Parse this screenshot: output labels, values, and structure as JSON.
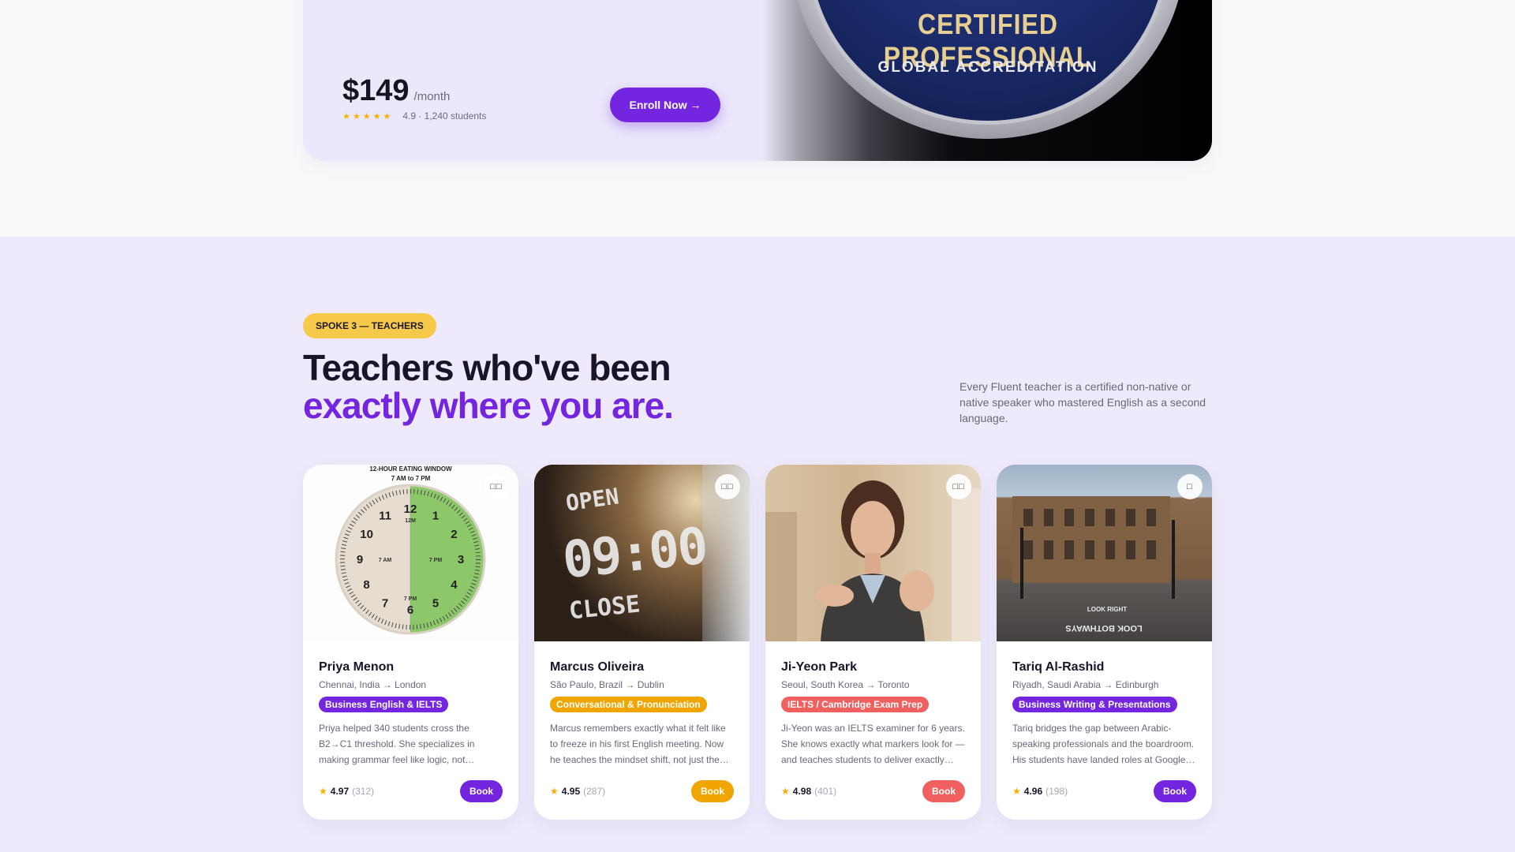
{
  "course": {
    "badge_title": "CERTIFIED PROFESSIONAL",
    "badge_subtitle": "GLOBAL ACCREDITATION",
    "price": "$149",
    "price_unit": "/month",
    "rating_stars": "★★★★★",
    "rating_text": "4.9 · 1,240 students",
    "enroll_label": "Enroll Now →"
  },
  "teachers_section": {
    "tag": "SPOKE 3 — TEACHERS",
    "headline_line1": "Teachers who've been",
    "headline_line2": "exactly where you are.",
    "description": "Every Fluent teacher is a certified non-native or native speaker who mastered English as a second language."
  },
  "teachers": [
    {
      "name": "Priya Menon",
      "route": "Chennai, India → London",
      "specialty": "Business English & IELTS",
      "bio": "Priya helped 340 students cross the B2→C1 threshold. She specializes in making grammar feel like logic, not…",
      "star": "★",
      "rating": "4.97",
      "reviews": "(312)",
      "book_label": "Book",
      "photo_icon": "□□",
      "accent": "#7425e0"
    },
    {
      "name": "Marcus Oliveira",
      "route": "São Paulo, Brazil → Dublin",
      "specialty": "Conversational & Pronunciation",
      "bio": "Marcus remembers exactly what it felt like to freeze in his first English meeting. Now he teaches the mindset shift, not just the…",
      "star": "★",
      "rating": "4.95",
      "reviews": "(287)",
      "book_label": "Book",
      "photo_icon": "□□",
      "accent": "#f0a500"
    },
    {
      "name": "Ji-Yeon Park",
      "route": "Seoul, South Korea → Toronto",
      "specialty": "IELTS / Cambridge Exam Prep",
      "bio": "Ji-Yeon was an IELTS examiner for 6 years. She knows exactly what markers look for — and teaches students to deliver exactly…",
      "star": "★",
      "rating": "4.98",
      "reviews": "(401)",
      "book_label": "Book",
      "photo_icon": "□□",
      "accent": "#f0605f"
    },
    {
      "name": "Tariq Al-Rashid",
      "route": "Riyadh, Saudi Arabia → Edinburgh",
      "specialty": "Business Writing & Presentations",
      "bio": "Tariq bridges the gap between Arabic-speaking professionals and the boardroom. His students have landed roles at Google…",
      "star": "★",
      "rating": "4.96",
      "reviews": "(198)",
      "book_label": "Book",
      "photo_icon": "□",
      "accent": "#7425e0"
    }
  ],
  "photo_texts": {
    "clock_caption": "12-HOUR EATING WINDOW",
    "clock_subcaption": "7 AM to 7 PM",
    "clock_numbers": [
      "12",
      "1",
      "2",
      "3",
      "4",
      "5",
      "6",
      "7",
      "8",
      "9",
      "10",
      "11"
    ],
    "clock_labels": [
      "12M",
      "7 AM",
      "7 PM",
      "7 PM"
    ],
    "cafe_open": "OPEN",
    "cafe_time": "09:00",
    "cafe_close": "CLOSE",
    "street_marking_1": "LOOK RIGHT",
    "street_marking_2": "LOOK BOTHWAYS"
  }
}
